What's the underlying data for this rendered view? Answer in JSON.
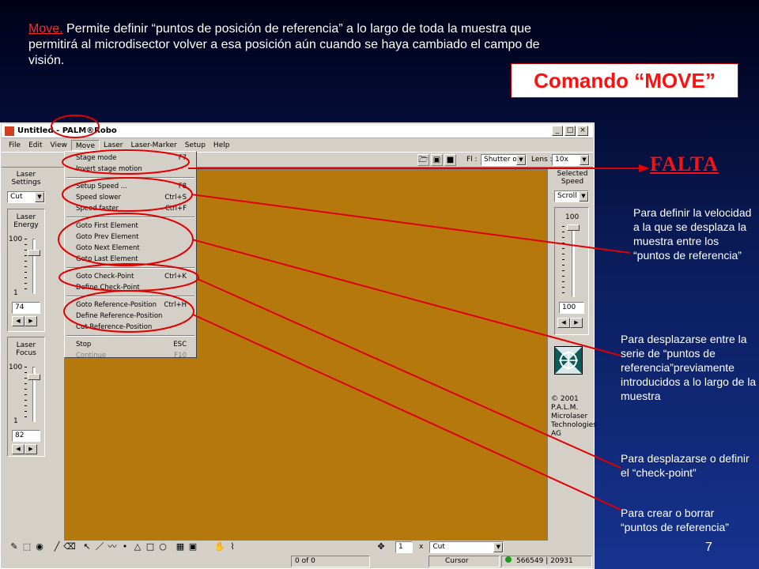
{
  "slide": {
    "intro_keyword": "Move.",
    "intro_text": " Permite definir “puntos de posición de referencia” a lo largo de toda la muestra que permitirá al microdisector volver a esa posición aún cuando se haya cambiado el campo de visión.",
    "command_title": "Comando “MOVE”",
    "falta": "FALTA",
    "page_number": "7",
    "notes": [
      "Para definir la velocidad a la que se desplaza la muestra entre los “puntos de referencia”",
      "Para desplazarse entre la serie de “puntos de referencia”previamente introducidos a lo largo de la muestra",
      "Para desplazarse o definir el “check-point”",
      "Para crear o borrar “puntos de referencia”"
    ],
    "accent_color": "#ff1010"
  },
  "window": {
    "title": "Untitled - PALM®Robo",
    "buttons": [
      "_",
      "□",
      "×"
    ],
    "menu": [
      "File",
      "Edit",
      "View",
      "Move",
      "Laser",
      "Laser-Marker",
      "Setup",
      "Help"
    ]
  },
  "toolbar": {
    "fl_label": "Fl :",
    "fl_value": "Shutter off",
    "lens_label": "Lens :",
    "lens_value": "10x",
    "icons": [
      "folder-icon",
      "camera-icon",
      "monitor-icon"
    ]
  },
  "move_menu": [
    {
      "label": "Stage mode",
      "shortcut": "F7"
    },
    {
      "label": "Invert stage motion",
      "shortcut": ""
    },
    {
      "sep": true
    },
    {
      "label": "Setup Speed ...",
      "shortcut": "F8"
    },
    {
      "label": "Speed slower",
      "shortcut": "Ctrl+S"
    },
    {
      "label": "Speed faster",
      "shortcut": "Ctrl+F"
    },
    {
      "sep": true
    },
    {
      "label": "Goto First Element",
      "shortcut": ""
    },
    {
      "label": "Goto Prev Element",
      "shortcut": ""
    },
    {
      "label": "Goto Next Element",
      "shortcut": ""
    },
    {
      "label": "Goto Last Element",
      "shortcut": ""
    },
    {
      "sep": true
    },
    {
      "label": "Goto Check-Point",
      "shortcut": "Ctrl+K"
    },
    {
      "label": "Define Check-Point",
      "shortcut": ""
    },
    {
      "sep": true
    },
    {
      "label": "Goto Reference-Position",
      "shortcut": "Ctrl+H"
    },
    {
      "label": "Define Reference-Position",
      "shortcut": ""
    },
    {
      "label": "Cut Reference-Position",
      "shortcut": ""
    },
    {
      "sep": true
    },
    {
      "label": "Stop",
      "shortcut": "ESC"
    },
    {
      "label": "Continue",
      "shortcut": "F10",
      "disabled": true
    }
  ],
  "left_panel": {
    "laser_settings": "Laser Settings",
    "mode_value": "Cut",
    "energy_label": "Laser Energy",
    "energy_max": "100",
    "energy_min": "1",
    "energy_value": "74",
    "focus_label": "Laser Focus",
    "focus_max": "100",
    "focus_min": "1",
    "focus_value": "82"
  },
  "right_panel": {
    "speed_label": "Selected Speed",
    "speed_mode": "Scroll",
    "speed_max": "100",
    "speed_value": "100",
    "copyright": "© 2001 P.A.L.M. Microlaser Technologies AG"
  },
  "bottom_bar": {
    "count_value": "1",
    "count_suffix": "x",
    "mode_value": "Cut",
    "status_items": "0 of 0",
    "status_cursor": "Cursor",
    "status_coords": "566549 | 20931"
  }
}
